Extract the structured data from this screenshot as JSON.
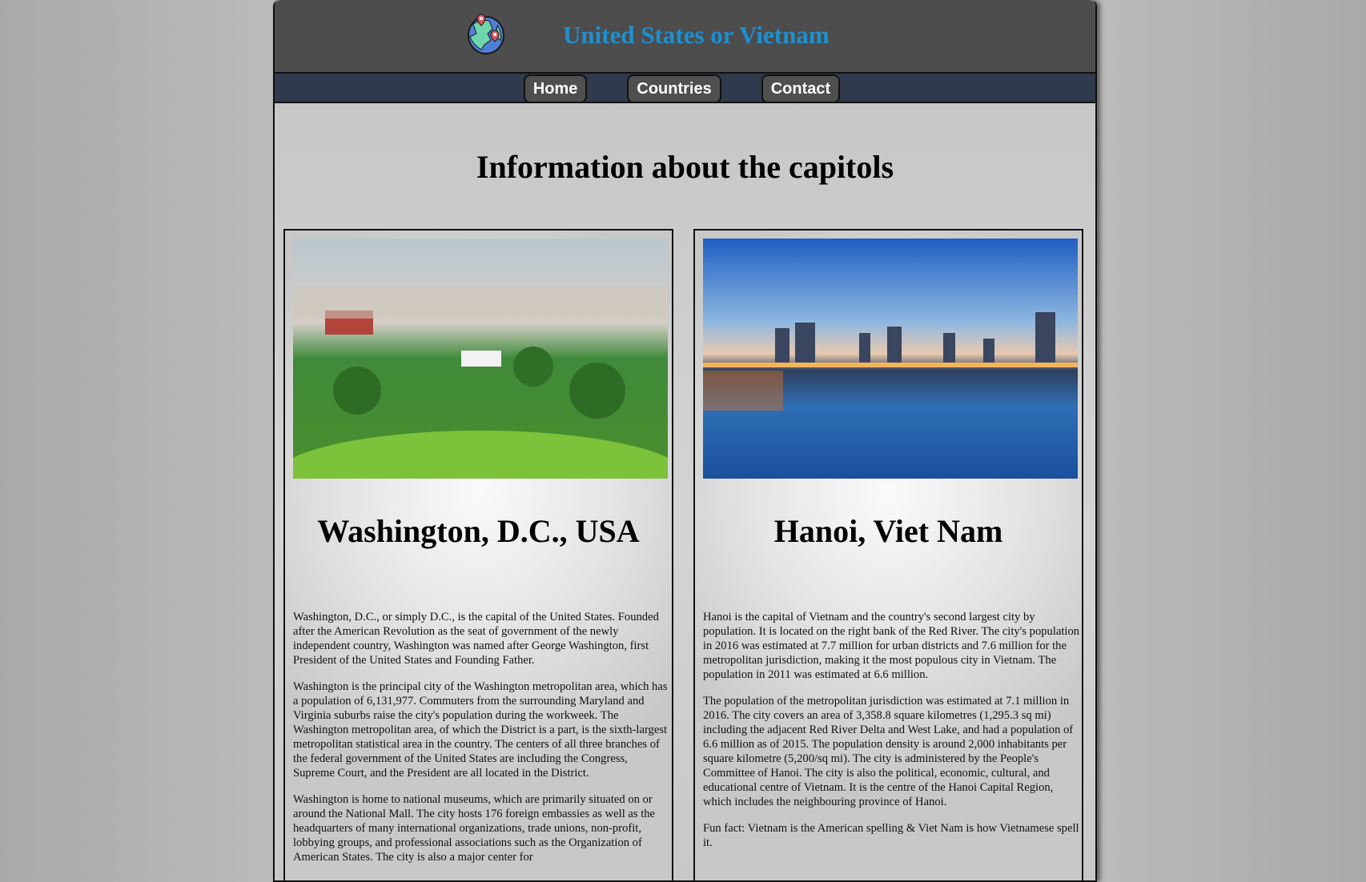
{
  "header": {
    "title": "United States or Vietnam",
    "logo_icon": "globe-with-pins-icon"
  },
  "nav": {
    "items": [
      {
        "label": "Home"
      },
      {
        "label": "Countries"
      },
      {
        "label": "Contact"
      }
    ]
  },
  "main": {
    "title": "Information about the capitols"
  },
  "cards": [
    {
      "title": "Washington, D.C., USA",
      "image": "aerial view of Washington D.C.",
      "paragraphs": [
        "Washington, D.C., or simply D.C., is the capital of the United States. Founded after the American Revolution as the seat of government of the newly independent country, Washington was named after George Washington, first President of the United States and Founding Father.",
        "Washington is the principal city of the Washington metropolitan area, which has a population of 6,131,977. Commuters from the surrounding Maryland and Virginia suburbs raise the city's population during the workweek. The Washington metropolitan area, of which the District is a part, is the sixth-largest metropolitan statistical area in the country. The centers of all three branches of the federal government of the United States are including the Congress, Supreme Court, and the President are all located in the District.",
        "Washington is home to national museums, which are primarily situated on or around the National Mall. The city hosts 176 foreign embassies as well as the headquarters of many international organizations, trade unions, non-profit, lobbying groups, and professional associations such as the Organization of American States. The city is also a major center for"
      ]
    },
    {
      "title": "Hanoi, Viet Nam",
      "image": "Hanoi skyline over the lake",
      "paragraphs": [
        "Hanoi is the capital of Vietnam and the country's second largest city by population. It is located on the right bank of the Red River. The city's population in 2016 was estimated at 7.7 million for urban districts and 7.6 million for the metropolitan jurisdiction, making it the most populous city in Vietnam. The population in 2011 was estimated at 6.6 million.",
        "The population of the metropolitan jurisdiction was estimated at 7.1 million in 2016. The city covers an area of 3,358.8 square kilometres (1,295.3 sq mi) including the adjacent Red River Delta and West Lake, and had a population of 6.6 million as of 2015. The population density is around 2,000 inhabitants per square kilometre (5,200/sq mi). The city is administered by the People's Committee of Hanoi. The city is also the political, economic, cultural, and educational centre of Vietnam. It is the centre of the Hanoi Capital Region, which includes the neighbouring province of Hanoi.",
        "Fun fact: Vietnam is the American spelling & Viet Nam is how Vietnamese spell it."
      ]
    }
  ]
}
